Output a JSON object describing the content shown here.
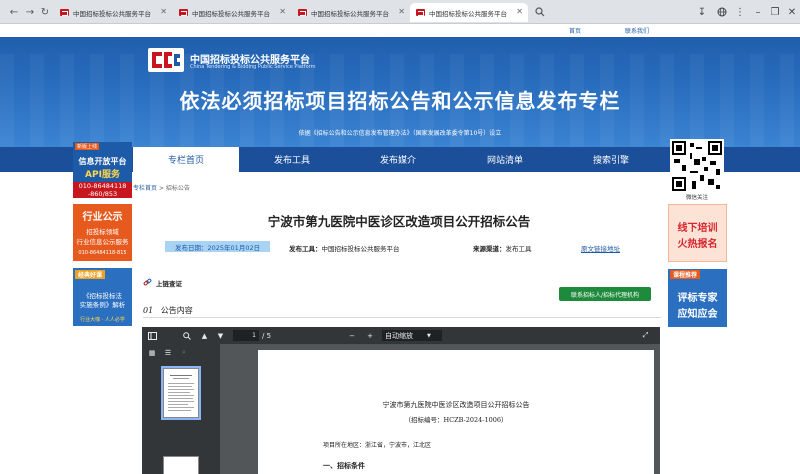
{
  "browser": {
    "tabs": [
      {
        "title": "中国招标投标公共服务平台"
      },
      {
        "title": "中国招标投标公共服务平台"
      },
      {
        "title": "中国招标投标公共服务平台"
      },
      {
        "title": "中国招标投标公共服务平台"
      }
    ],
    "active_tab": 3
  },
  "header": {
    "top_links": {
      "home": "首页",
      "contact": "联系我们"
    },
    "logo_cn": "中国招标投标公共服务平台",
    "logo_en": "China Tendering & Bidding Public Service Platform",
    "title": "依法必须招标项目招标公告和公示信息发布专栏",
    "subtitle": "依据《招标公告和公示信息发布管理办法》（国家发展改革委令第10号）设立"
  },
  "nav": {
    "items": [
      "专栏首页",
      "发布工具",
      "发布媒介",
      "网站清单",
      "搜索引擎"
    ],
    "active_index": 0
  },
  "left_ads": {
    "ad1": {
      "tag": "新版上线",
      "line1": "信息开放平台",
      "line2": "API服务",
      "phone": "010-86484118 -860/853"
    },
    "ad2": {
      "line1": "行业公示",
      "line2": "招投标领域",
      "line3": "行业信息公示服务",
      "phone": "010-86484118-815"
    },
    "ad3": {
      "tag": "经典好课",
      "line1": "《招标投标法",
      "line2": "实施条例》解析",
      "line3": "行业大咖 · 人人必学"
    }
  },
  "right_ads": {
    "qr_label": "微信关注",
    "ad1": {
      "line1": "线下培训",
      "line2": "火热报名"
    },
    "ad2": {
      "tag": "课程推荐",
      "line1": "评标专家",
      "line2": "应知应会"
    }
  },
  "breadcrumb": {
    "home": "专栏首页",
    "sep": ">",
    "current": "招标公告"
  },
  "notice": {
    "title": "宁波市第九医院中医诊区改造项目公开招标公告",
    "date_label": "发布日期：",
    "date": "2025年01月02日",
    "tool_label": "发布工具：",
    "tool": "中国招标投标公共服务平台",
    "channel_label": "来源渠道：",
    "channel": "发布工具",
    "original_link": "原文链接地址"
  },
  "chain_verify": "上链查证",
  "contact_button": "联系招标人/招标代理机构",
  "section": {
    "num": "01",
    "label": "公告内容"
  },
  "pdf": {
    "page_current": "1",
    "page_total": "/ 5",
    "zoom": "自动缩放",
    "doc_title": "宁波市第九医院中医诊区改造项目公开招标公告",
    "doc_no": "（招标编号：HCZB-2024-1006）",
    "doc_location": "项目所在地区：浙江省，宁波市，江北区",
    "doc_section": "一、招标条件"
  },
  "colors": {
    "header_blue": "#1d5aa8",
    "nav_blue": "#1b4f99",
    "contact_green": "#1e8a3c",
    "date_bg": "#a9d3f3",
    "ad_orange": "#e65a1e",
    "ad_red": "#d7262d"
  }
}
